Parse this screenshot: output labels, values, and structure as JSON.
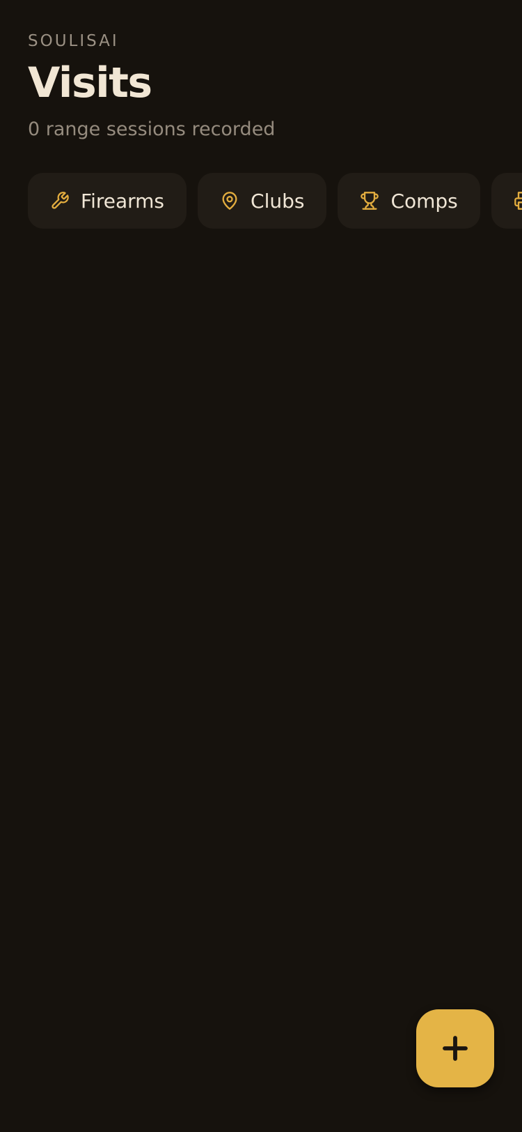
{
  "header": {
    "brand": "SOULISAI",
    "title": "Visits",
    "subtitle": "0 range sessions recorded"
  },
  "chips": [
    {
      "label": "Firearms",
      "icon": "wrench-icon"
    },
    {
      "label": "Clubs",
      "icon": "map-pin-icon"
    },
    {
      "label": "Comps",
      "icon": "trophy-icon"
    },
    {
      "label": "",
      "icon": "printer-icon"
    }
  ],
  "fab": {
    "icon": "plus-icon"
  },
  "colors": {
    "background": "#16120d",
    "chip_background": "#211c16",
    "accent": "#e4b446",
    "text_primary": "#f0e6d6",
    "text_secondary": "#958b7e"
  }
}
